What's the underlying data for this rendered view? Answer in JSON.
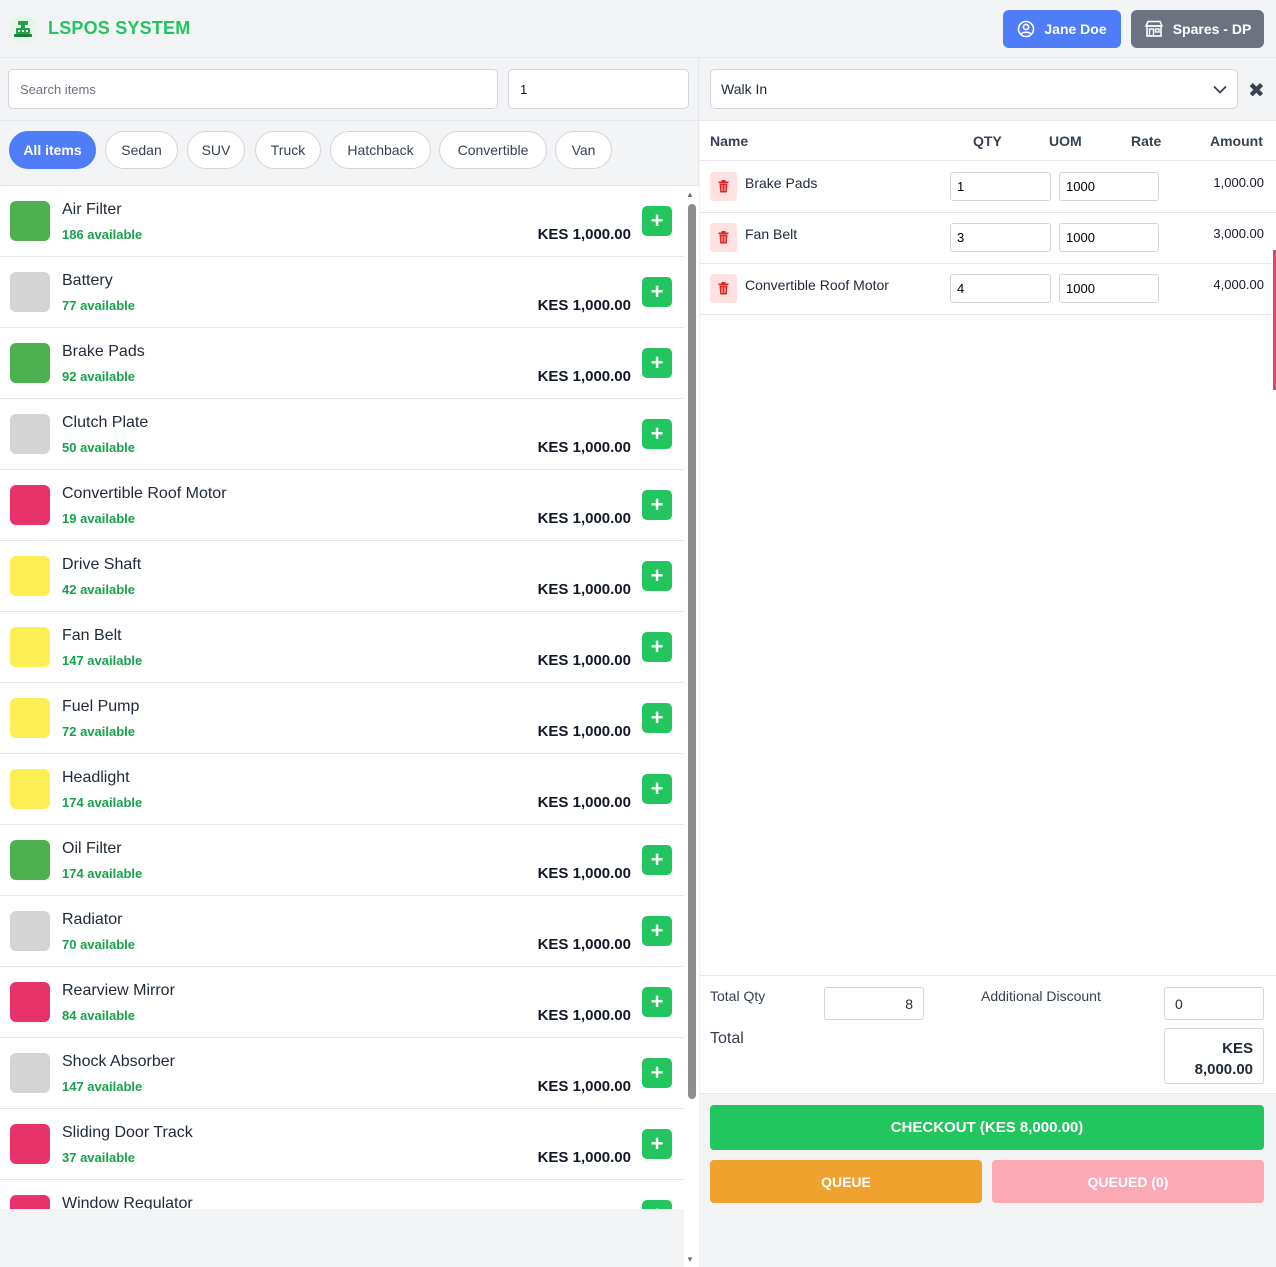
{
  "app": {
    "title": "LSPOS SYSTEM",
    "logo_icon": "cash-register-icon"
  },
  "header": {
    "user_label": "Jane Doe",
    "user_icon": "user-circle-icon",
    "store_label": "Spares - DP",
    "store_icon": "store-icon"
  },
  "search": {
    "placeholder": "Search items",
    "value": "",
    "qty_value": "1"
  },
  "categories": [
    "All items",
    "Sedan",
    "SUV",
    "Truck",
    "Hatchback",
    "Convertible",
    "Van"
  ],
  "active_category": "All items",
  "items": [
    {
      "name": "Air Filter",
      "available": "186 available",
      "price": "KES 1,000.00",
      "color": "#4caf50"
    },
    {
      "name": "Battery",
      "available": "77 available",
      "price": "KES 1,000.00",
      "color": "#d4d4d4"
    },
    {
      "name": "Brake Pads",
      "available": "92 available",
      "price": "KES 1,000.00",
      "color": "#4caf50"
    },
    {
      "name": "Clutch Plate",
      "available": "50 available",
      "price": "KES 1,000.00",
      "color": "#d4d4d4"
    },
    {
      "name": "Convertible Roof Motor",
      "available": "19 available",
      "price": "KES 1,000.00",
      "color": "#e8336a"
    },
    {
      "name": "Drive Shaft",
      "available": "42 available",
      "price": "KES 1,000.00",
      "color": "#fbef55"
    },
    {
      "name": "Fan Belt",
      "available": "147 available",
      "price": "KES 1,000.00",
      "color": "#fbef55"
    },
    {
      "name": "Fuel Pump",
      "available": "72 available",
      "price": "KES 1,000.00",
      "color": "#fbef55"
    },
    {
      "name": "Headlight",
      "available": "174 available",
      "price": "KES 1,000.00",
      "color": "#fbef55"
    },
    {
      "name": "Oil Filter",
      "available": "174 available",
      "price": "KES 1,000.00",
      "color": "#4caf50"
    },
    {
      "name": "Radiator",
      "available": "70 available",
      "price": "KES 1,000.00",
      "color": "#d4d4d4"
    },
    {
      "name": "Rearview Mirror",
      "available": "84 available",
      "price": "KES 1,000.00",
      "color": "#e8336a"
    },
    {
      "name": "Shock Absorber",
      "available": "147 available",
      "price": "KES 1,000.00",
      "color": "#d4d4d4"
    },
    {
      "name": "Sliding Door Track",
      "available": "37 available",
      "price": "KES 1,000.00",
      "color": "#e8336a"
    },
    {
      "name": "Window Regulator",
      "available": "",
      "price": "",
      "color": "#e8336a"
    }
  ],
  "customer": {
    "value": "Walk In"
  },
  "cart": {
    "headers": {
      "name": "Name",
      "qty": "QTY",
      "uom": "UOM",
      "rate": "Rate",
      "amount": "Amount"
    },
    "rows": [
      {
        "name": "Brake Pads",
        "qty": "1",
        "rate": "1000",
        "amount": "1,000.00"
      },
      {
        "name": "Fan Belt",
        "qty": "3",
        "rate": "1000",
        "amount": "3,000.00"
      },
      {
        "name": "Convertible Roof Motor",
        "qty": "4",
        "rate": "1000",
        "amount": "4,000.00"
      }
    ]
  },
  "totals": {
    "total_qty_label": "Total Qty",
    "total_qty": "8",
    "discount_label": "Additional Discount",
    "discount": "0",
    "total_label": "Total",
    "total_currency": "KES",
    "total_value": "8,000.00"
  },
  "actions": {
    "checkout": "CHECKOUT (KES 8,000.00)",
    "queue": "QUEUE",
    "queued": "QUEUED (0)"
  },
  "colors": {
    "brand_green": "#22c55e",
    "primary_blue": "#4f7cf7",
    "queue_orange": "#f0a22e",
    "queued_pink": "#fba9b5",
    "delete_red": "#dc2626"
  }
}
